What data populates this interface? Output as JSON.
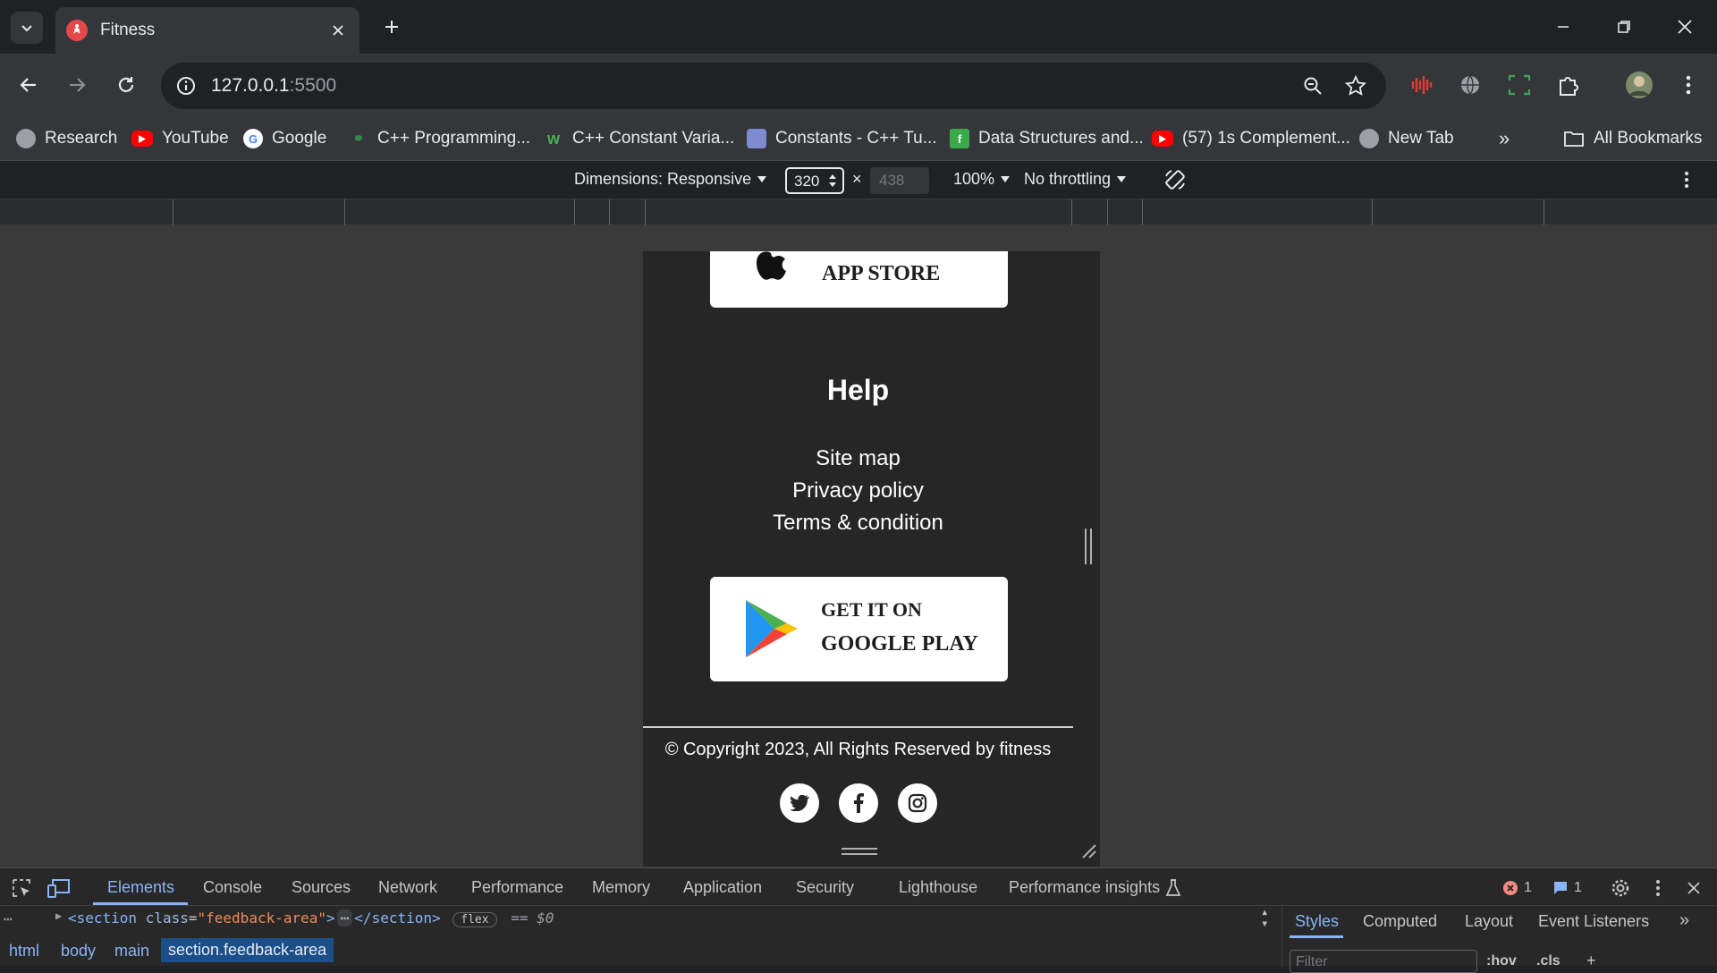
{
  "browser": {
    "tab_title": "Fitness",
    "url_host": "127.0.0.1",
    "url_port": ":5500"
  },
  "bookmarks": [
    {
      "label": "Research",
      "icon": "globe-icon",
      "color": "#9aa0a6"
    },
    {
      "label": "YouTube",
      "icon": "youtube-icon",
      "color": "#ff0000"
    },
    {
      "label": "Google",
      "icon": "google-icon",
      "color": "#ffffff"
    },
    {
      "label": "C++ Programming...",
      "icon": "geeks-icon",
      "color": "#2f8d46"
    },
    {
      "label": "C++ Constant Varia...",
      "icon": "w3-icon",
      "color": "#4caf50"
    },
    {
      "label": "Constants - C++ Tu...",
      "icon": "cplusplus-icon",
      "color": "#7e8bd1"
    },
    {
      "label": "Data Structures and...",
      "icon": "programiz-icon",
      "color": "#3aa94a"
    },
    {
      "label": "(57) 1s Complement...",
      "icon": "youtube-icon",
      "color": "#ff0000"
    },
    {
      "label": "New Tab",
      "icon": "globe-icon",
      "color": "#9aa0a6"
    }
  ],
  "bookmarks_more": "»",
  "all_bookmarks": "All Bookmarks",
  "device_toolbar": {
    "dimensions_label": "Dimensions: Responsive",
    "width": "320",
    "times": "×",
    "height": "438",
    "zoom": "100%",
    "throttling": "No throttling"
  },
  "page": {
    "app_store_label": "APP STORE",
    "help_title": "Help",
    "help_links": [
      "Site map",
      "Privacy policy",
      "Terms & condition"
    ],
    "google_play_top": "GET IT ON",
    "google_play_bottom": "GOOGLE PLAY",
    "copyright": "© Copyright 2023, All Rights Reserved by fitness",
    "social": [
      "twitter-icon",
      "facebook-icon",
      "instagram-icon"
    ]
  },
  "devtools": {
    "tabs": [
      "Elements",
      "Console",
      "Sources",
      "Network",
      "Performance",
      "Memory",
      "Application",
      "Security",
      "Lighthouse",
      "Performance insights"
    ],
    "active_tab": "Elements",
    "error_count": "1",
    "message_count": "1",
    "dom_line": {
      "tag_open": "<section",
      "attr_name": "class",
      "attr_value": "\"feedback-area\"",
      "tag_close": "</section>",
      "badge": "flex",
      "eq": "== $0"
    },
    "breadcrumbs": [
      "html",
      "body",
      "main",
      "section.feedback-area"
    ],
    "side_tabs": [
      "Styles",
      "Computed",
      "Layout",
      "Event Listeners"
    ],
    "side_more": "»",
    "filter_placeholder": "Filter",
    "hov": ":hov",
    "cls": ".cls"
  }
}
